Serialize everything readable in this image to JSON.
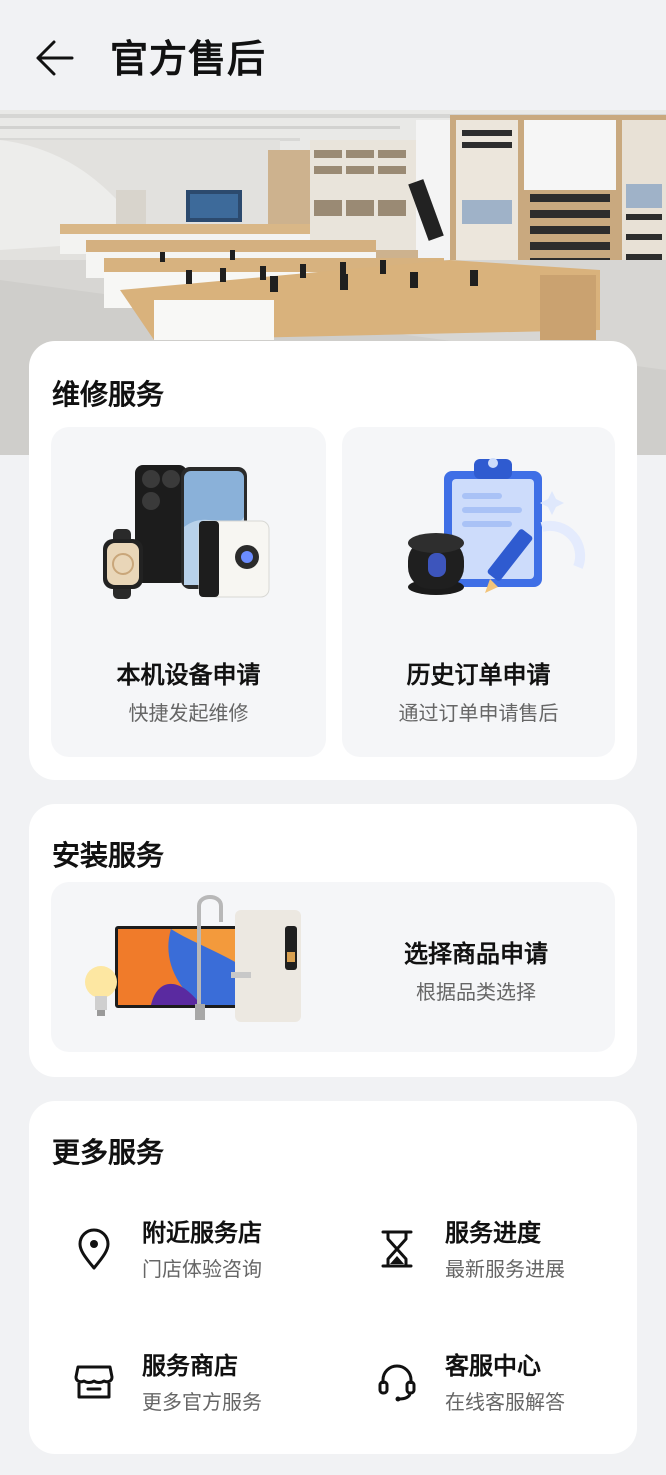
{
  "header": {
    "title": "官方售后",
    "back_icon": "arrow-left-icon"
  },
  "repair": {
    "title": "维修服务",
    "tiles": [
      {
        "title": "本机设备申请",
        "subtitle": "快捷发起维修"
      },
      {
        "title": "历史订单申请",
        "subtitle": "通过订单申请售后"
      }
    ]
  },
  "install": {
    "title": "安装服务",
    "tile": {
      "title": "选择商品申请",
      "subtitle": "根据品类选择"
    }
  },
  "more": {
    "title": "更多服务",
    "items": [
      {
        "label": "附近服务店",
        "subtitle": "门店体验咨询",
        "icon": "location-pin-icon"
      },
      {
        "label": "服务进度",
        "subtitle": "最新服务进展",
        "icon": "hourglass-icon"
      },
      {
        "label": "服务商店",
        "subtitle": "更多官方服务",
        "icon": "store-icon"
      },
      {
        "label": "客服中心",
        "subtitle": "在线客服解答",
        "icon": "headset-icon"
      }
    ]
  },
  "colors": {
    "background": "#f1f2f4",
    "card": "#ffffff",
    "tile": "#f5f6f8",
    "text_primary": "#111111",
    "text_secondary": "#666666"
  }
}
